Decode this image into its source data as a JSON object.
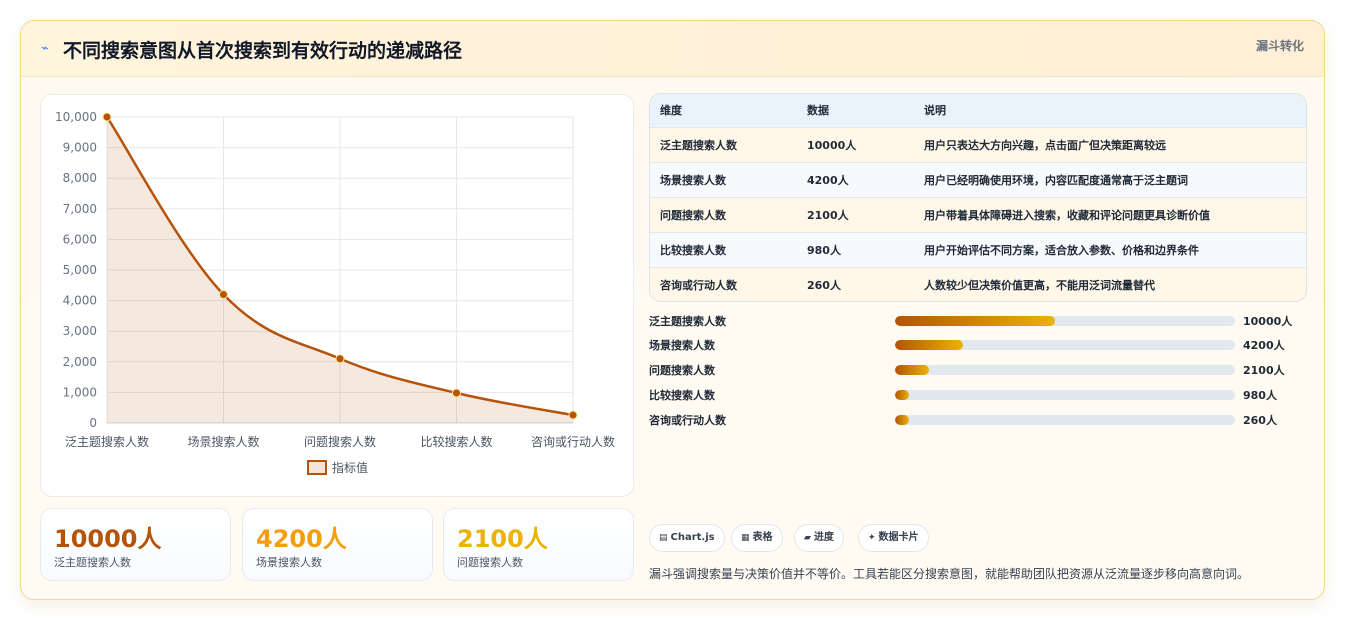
{
  "header": {
    "title": "不同搜索意图从首次搜索到有效行动的递减路径",
    "tag": "漏斗转化",
    "icon": "⌁"
  },
  "chart_data": {
    "type": "line",
    "categories": [
      "泛主题搜索人数",
      "场景搜索人数",
      "问题搜索人数",
      "比较搜索人数",
      "咨询或行动人数"
    ],
    "series": [
      {
        "name": "指标值",
        "values": [
          10000,
          4200,
          2100,
          980,
          260
        ]
      }
    ],
    "yticks": [
      "10,000",
      "9,000",
      "8,000",
      "7,000",
      "6,000",
      "5,000",
      "4,000",
      "3,000",
      "2,000",
      "1,000",
      "0"
    ],
    "ylim": [
      0,
      10000
    ],
    "grid": true,
    "legend": "bottom",
    "fill": true,
    "color": "#b45309"
  },
  "kpis": [
    {
      "value": "10000人",
      "label": "泛主题搜索人数",
      "color": "#b45309"
    },
    {
      "value": "4200人",
      "label": "场景搜索人数",
      "color": "#f59e0b"
    },
    {
      "value": "2100人",
      "label": "问题搜索人数",
      "color": "#eab308"
    }
  ],
  "table": {
    "headers": [
      "维度",
      "数据",
      "说明"
    ],
    "rows": [
      [
        "泛主题搜索人数",
        "10000人",
        "用户只表达大方向兴趣，点击面广但决策距离较远"
      ],
      [
        "场景搜索人数",
        "4200人",
        "用户已经明确使用环境，内容匹配度通常高于泛主题词"
      ],
      [
        "问题搜索人数",
        "2100人",
        "用户带着具体障碍进入搜索，收藏和评论问题更具诊断价值"
      ],
      [
        "比较搜索人数",
        "980人",
        "用户开始评估不同方案，适合放入参数、价格和边界条件"
      ],
      [
        "咨询或行动人数",
        "260人",
        "人数较少但决策价值更高，不能用泛词流量替代"
      ]
    ]
  },
  "bars": [
    {
      "label": "泛主题搜索人数",
      "value": "10000人",
      "fraction": 0.47
    },
    {
      "label": "场景搜索人数",
      "value": "4200人",
      "fraction": 0.2
    },
    {
      "label": "问题搜索人数",
      "value": "2100人",
      "fraction": 0.1
    },
    {
      "label": "比较搜索人数",
      "value": "980人",
      "fraction": 0.04
    },
    {
      "label": "咨询或行动人数",
      "value": "260人",
      "fraction": 0.04
    }
  ],
  "chips": [
    {
      "icon": "▤",
      "label": "Chart.js"
    },
    {
      "icon": "▦",
      "label": "表格"
    },
    {
      "icon": "▰",
      "label": "进度"
    },
    {
      "icon": "✦",
      "label": "数据卡片"
    }
  ],
  "footnote": "漏斗强调搜索量与决策价值并不等价。工具若能区分搜索意图，就能帮助团队把资源从泛流量逐步移向高意向词。"
}
